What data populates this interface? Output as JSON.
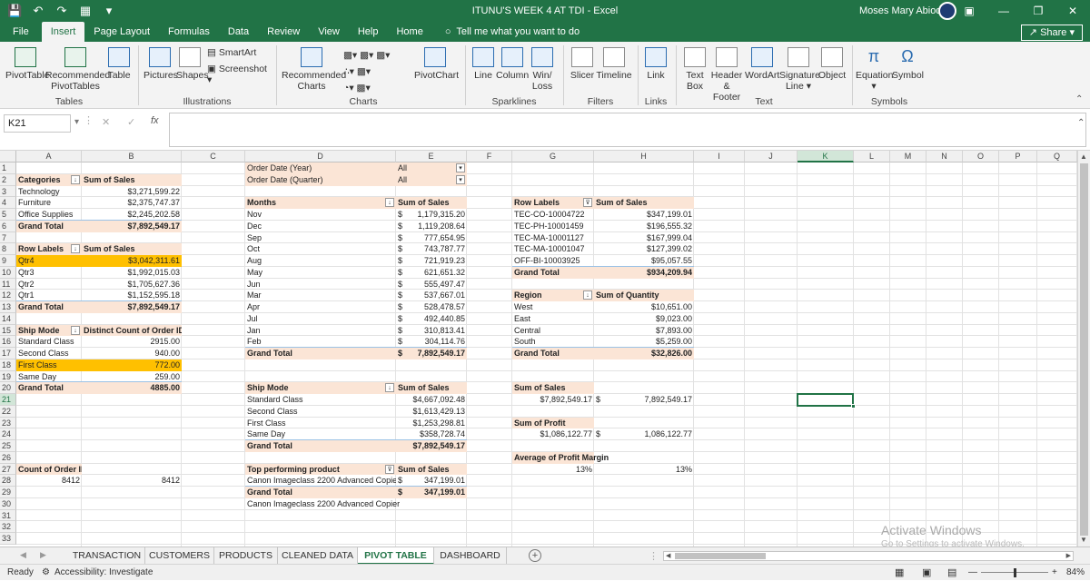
{
  "title": {
    "doc": "ITUNU'S WEEK 4 AT TDI  -  Excel",
    "user": "Moses Mary Abiodun"
  },
  "menu": {
    "tabs": [
      "File",
      "Insert",
      "Page Layout",
      "Formulas",
      "Data",
      "Review",
      "View",
      "Help",
      "Home"
    ],
    "tell_me": "Tell me what you want to do",
    "share": "Share"
  },
  "ribbon": {
    "pivottable": "PivotTable",
    "recommended_pivottables": "Recommended PivotTables",
    "table": "Table",
    "pictures": "Pictures",
    "shapes": "Shapes",
    "smartart": "SmartArt",
    "screenshot": "Screenshot",
    "recommended_charts": "Recommended Charts",
    "pivotchart": "PivotChart",
    "line": "Line",
    "column": "Column",
    "winloss": "Win/ Loss",
    "slicer": "Slicer",
    "timeline": "Timeline",
    "link": "Link",
    "textbox": "Text Box",
    "header_footer": "Header & Footer",
    "wordart": "WordArt",
    "signature_line": "Signature Line",
    "object": "Object",
    "equation": "Equation",
    "symbol": "Symbol",
    "groups": {
      "tables": "Tables",
      "illustrations": "Illustrations",
      "charts": "Charts",
      "sparklines": "Sparklines",
      "filters": "Filters",
      "links": "Links",
      "text": "Text",
      "symbols": "Symbols"
    }
  },
  "formula_bar": {
    "name_box": "K21",
    "fx": "fx",
    "formula": ""
  },
  "columns": [
    "A",
    "B",
    "C",
    "D",
    "E",
    "F",
    "G",
    "H",
    "I",
    "J",
    "K",
    "L",
    "M",
    "N",
    "O",
    "P",
    "Q"
  ],
  "rows": [
    "1",
    "2",
    "3",
    "4",
    "5",
    "6",
    "7",
    "8",
    "9",
    "10",
    "11",
    "12",
    "13",
    "14",
    "15",
    "16",
    "17",
    "18",
    "19",
    "20",
    "21",
    "22",
    "23",
    "24",
    "25",
    "26",
    "27",
    "28",
    "29",
    "30",
    "31",
    "32",
    "33"
  ],
  "pt_categories": {
    "header": [
      "Categories",
      "Sum of Sales"
    ],
    "rows": [
      [
        "Technology",
        "$3,271,599.22"
      ],
      [
        "Furniture",
        "$2,375,747.37"
      ],
      [
        "Office Supplies",
        "$2,245,202.58"
      ]
    ],
    "total": [
      "Grand Total",
      "$7,892,549.17"
    ]
  },
  "pt_quarters": {
    "header": [
      "Row Labels",
      "Sum of Sales"
    ],
    "rows": [
      [
        "Qtr4",
        "$3,042,311.61"
      ],
      [
        "Qtr3",
        "$1,992,015.03"
      ],
      [
        "Qtr2",
        "$1,705,627.36"
      ],
      [
        "Qtr1",
        "$1,152,595.18"
      ]
    ],
    "total": [
      "Grand Total",
      "$7,892,549.17"
    ]
  },
  "pt_shipmode_count": {
    "header": [
      "Ship Mode",
      "Distinct Count of Order ID"
    ],
    "rows": [
      [
        "Standard Class",
        "2915.00"
      ],
      [
        "Second Class",
        "940.00"
      ],
      [
        "First Class",
        "772.00"
      ],
      [
        "Same Day",
        "259.00"
      ]
    ],
    "total": [
      "Grand Total",
      "4885.00"
    ]
  },
  "pt_count_order": {
    "header": "Count of Order ID",
    "value": "8412",
    "value_b": "8412"
  },
  "pt_filters": {
    "rows": [
      [
        "Order Date (Year)",
        "All"
      ],
      [
        "Order Date (Quarter)",
        "All"
      ]
    ]
  },
  "pt_months": {
    "header": [
      "Months",
      "Sum of Sales"
    ],
    "currency": "$",
    "rows": [
      [
        "Nov",
        "1,179,315.20"
      ],
      [
        "Dec",
        "1,119,208.64"
      ],
      [
        "Sep",
        "777,654.95"
      ],
      [
        "Oct",
        "743,787.77"
      ],
      [
        "Aug",
        "721,919.23"
      ],
      [
        "May",
        "621,651.32"
      ],
      [
        "Jun",
        "555,497.47"
      ],
      [
        "Mar",
        "537,667.01"
      ],
      [
        "Apr",
        "528,478.57"
      ],
      [
        "Jul",
        "492,440.85"
      ],
      [
        "Jan",
        "310,813.41"
      ],
      [
        "Feb",
        "304,114.76"
      ]
    ],
    "total": [
      "Grand Total",
      "7,892,549.17"
    ]
  },
  "pt_shipmode_sales": {
    "header": [
      "Ship Mode",
      "Sum of Sales"
    ],
    "rows": [
      [
        "Standard Class",
        "$4,667,092.48"
      ],
      [
        "Second Class",
        "$1,613,429.13"
      ],
      [
        "First Class",
        "$1,253,298.81"
      ],
      [
        "Same Day",
        "$358,728.74"
      ]
    ],
    "total": [
      "Grand Total",
      "$7,892,549.17"
    ]
  },
  "pt_top_product": {
    "header": [
      "Top performing product",
      "Sum of Sales"
    ],
    "row": [
      "Canon Imageclass 2200 Advanced Copie",
      "$",
      "347,199.01"
    ],
    "total": [
      "Grand Total",
      "$",
      "347,199.01"
    ],
    "below": "Canon Imageclass 2200 Advanced Copier"
  },
  "pt_products": {
    "header": [
      "Row Labels",
      "Sum of Sales"
    ],
    "rows": [
      [
        "TEC-CO-10004722",
        "$347,199.01"
      ],
      [
        "TEC-PH-10001459",
        "$196,555.32"
      ],
      [
        "TEC-MA-10001127",
        "$167,999.04"
      ],
      [
        "TEC-MA-10001047",
        "$127,399.02"
      ],
      [
        "OFF-BI-10003925",
        "$95,057.55"
      ]
    ],
    "total": [
      "Grand Total",
      "$934,209.94"
    ]
  },
  "pt_region": {
    "header": [
      "Region",
      "Sum of Quantity"
    ],
    "rows": [
      [
        "West",
        "$10,651.00"
      ],
      [
        "East",
        "$9,023.00"
      ],
      [
        "Central",
        "$7,893.00"
      ],
      [
        "South",
        "$5,259.00"
      ]
    ],
    "total": [
      "Grand Total",
      "$32,826.00"
    ]
  },
  "kpis": {
    "sales_label": "Sum of Sales",
    "sales_g": "$7,892,549.17",
    "sales_h_cur": "$",
    "sales_h": "7,892,549.17",
    "profit_label": "Sum of Profit",
    "profit_g": "$1,086,122.77",
    "profit_h_cur": "$",
    "profit_h": "1,086,122.77",
    "margin_label": "Average of Profit Margin",
    "margin_g": "13%",
    "margin_h": "13%"
  },
  "sheets": [
    "TRANSACTION",
    "CUSTOMERS",
    "PRODUCTS",
    "CLEANED DATA",
    "PIVOT TABLE",
    "DASHBOARD"
  ],
  "active_sheet": "PIVOT TABLE",
  "watermark": {
    "line1": "Activate Windows",
    "line2": "Go to Settings to activate Windows."
  },
  "status": {
    "ready": "Ready",
    "accessibility": "Accessibility: Investigate",
    "zoom": "84%"
  },
  "colors": {
    "accent": "#217346",
    "header_fill": "#fbe5d6",
    "highlight": "#ffc000"
  }
}
